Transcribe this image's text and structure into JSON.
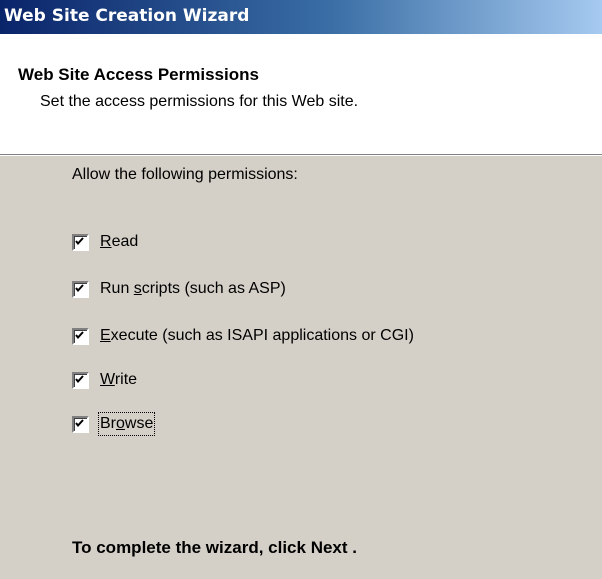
{
  "window": {
    "title": "Web Site Creation Wizard"
  },
  "header": {
    "heading": "Web Site Access Permissions",
    "subheading": "Set the access permissions for this Web site."
  },
  "permissions": {
    "prompt": "Allow the following permissions:",
    "items": [
      {
        "pre": "",
        "acc": "R",
        "post": "ead",
        "checked": true
      },
      {
        "pre": "Run ",
        "acc": "s",
        "post": "cripts (such as ASP)",
        "checked": true
      },
      {
        "pre": "",
        "acc": "E",
        "post": "xecute (such as ISAPI applications or CGI)",
        "checked": true
      },
      {
        "pre": "",
        "acc": "W",
        "post": "rite",
        "checked": true
      },
      {
        "pre": "Br",
        "acc": "o",
        "post": "wse",
        "checked": true
      }
    ]
  },
  "footer": {
    "instruction": "To complete the wizard, click Next ."
  },
  "colors": {
    "titlebar_start": "#0a246a",
    "titlebar_end": "#a6caf0",
    "dialog_background": "#d4d0c8",
    "header_background": "#ffffff"
  }
}
